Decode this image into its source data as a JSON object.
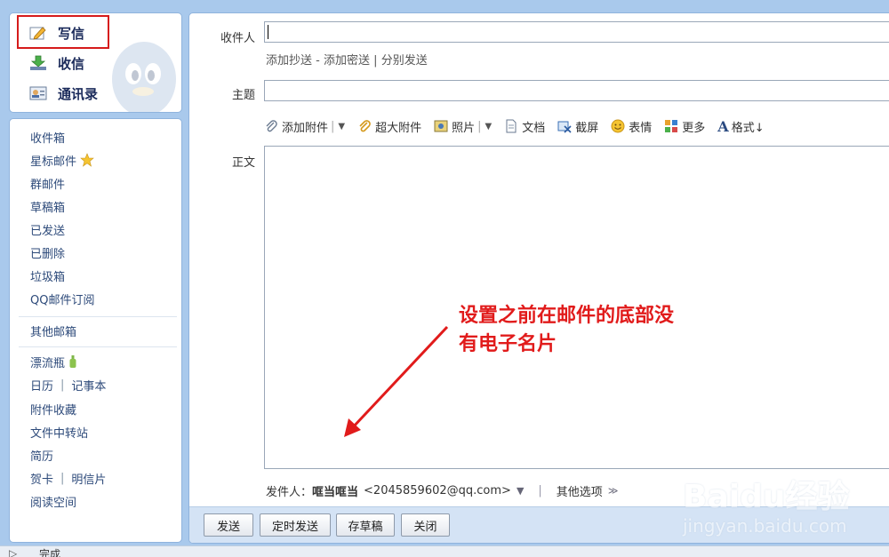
{
  "sidebar_top": {
    "items": [
      {
        "label": "写信",
        "icon": "compose-pencil-icon"
      },
      {
        "label": "收信",
        "icon": "inbox-download-icon"
      },
      {
        "label": "通讯录",
        "icon": "contacts-card-icon"
      }
    ]
  },
  "sidebar_nav": {
    "folders": [
      "收件箱",
      "星标邮件",
      "群邮件",
      "草稿箱",
      "已发送",
      "已删除",
      "垃圾箱",
      "QQ邮件订阅"
    ],
    "other_mailbox": "其他邮箱",
    "apps": {
      "drift_bottle": "漂流瓶",
      "calendar": "日历",
      "notebook": "记事本",
      "attachment_collection": "附件收藏",
      "file_transfer": "文件中转站",
      "resume": "简历",
      "greeting_card": "贺卡",
      "postcard": "明信片",
      "reading_space": "阅读空间"
    }
  },
  "compose": {
    "to_label": "收件人",
    "cc_link": "添加抄送",
    "link_sep": "-",
    "bcc_link": "添加密送",
    "pipe": "|",
    "separate_send_link": "分别发送",
    "subject_label": "主题",
    "body_label": "正文",
    "toolbar": {
      "attach": "添加附件",
      "large_attach": "超大附件",
      "photo": "照片",
      "document": "文档",
      "screenshot": "截屏",
      "emoji": "表情",
      "more": "更多",
      "format": "格式↓"
    },
    "sender_label": "发件人：",
    "sender_name": "哐当哐当",
    "sender_email": "<2045859602@qq.com>",
    "other_options": "其他选项"
  },
  "buttons": {
    "send": "发送",
    "scheduled_send": "定时发送",
    "save_draft": "存草稿",
    "close": "关闭"
  },
  "annotation": {
    "line1": "设置之前在邮件的底部没",
    "line2": "有电子名片",
    "color": "#e11b1b"
  },
  "status": {
    "text": "完成"
  },
  "watermark": {
    "main": "Baidu经验",
    "sub": "jingyan.baidu.com"
  },
  "colors": {
    "background": "#a9c9ec",
    "highlight_box": "#d61b1b",
    "link": "#2d4a7a"
  }
}
